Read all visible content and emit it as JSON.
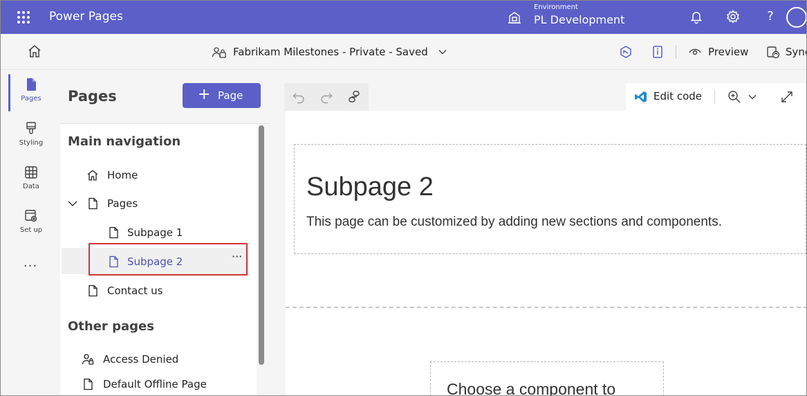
{
  "app": {
    "name": "Power Pages"
  },
  "environment": {
    "label": "Environment",
    "name": "PL Development"
  },
  "topbar_icons": [
    "bell-icon",
    "settings-icon",
    "help-icon",
    "account-icon"
  ],
  "site": {
    "title": "Fabrikam Milestones - Private - Saved"
  },
  "commands": {
    "preview_label": "Preview",
    "sync_label": "Sync"
  },
  "rail": {
    "items": [
      {
        "label": "Pages",
        "icon": "page-icon",
        "active": true
      },
      {
        "label": "Styling",
        "icon": "brush-icon"
      },
      {
        "label": "Data",
        "icon": "table-icon"
      },
      {
        "label": "Set up",
        "icon": "setup-icon"
      }
    ],
    "more": "..."
  },
  "panel": {
    "title": "Pages",
    "add_button": "Page",
    "main_navigation": {
      "heading": "Main navigation",
      "items": [
        {
          "label": "Home",
          "icon": "home-icon"
        },
        {
          "label": "Pages",
          "icon": "page-icon",
          "expanded": true
        },
        {
          "label": "Subpage 1",
          "icon": "page-icon"
        },
        {
          "label": "Subpage 2",
          "icon": "page-icon",
          "selected": true
        },
        {
          "label": "Contact us",
          "icon": "page-icon"
        }
      ]
    },
    "other_pages": {
      "heading": "Other pages",
      "items": [
        {
          "label": "Access Denied",
          "icon": "person-lock-icon"
        },
        {
          "label": "Default Offline Page",
          "icon": "page-icon"
        }
      ]
    },
    "item_menu": "···"
  },
  "canvas_toolbar": {
    "edit_code": "Edit code"
  },
  "page_content": {
    "heading": "Subpage 2",
    "description": "This page can be customized by adding new sections and components.",
    "component_prompt": "Choose a component to"
  },
  "colors": {
    "brand": "#5b5fc7",
    "selected_text": "#4f52b2",
    "highlight": "#d13438"
  }
}
